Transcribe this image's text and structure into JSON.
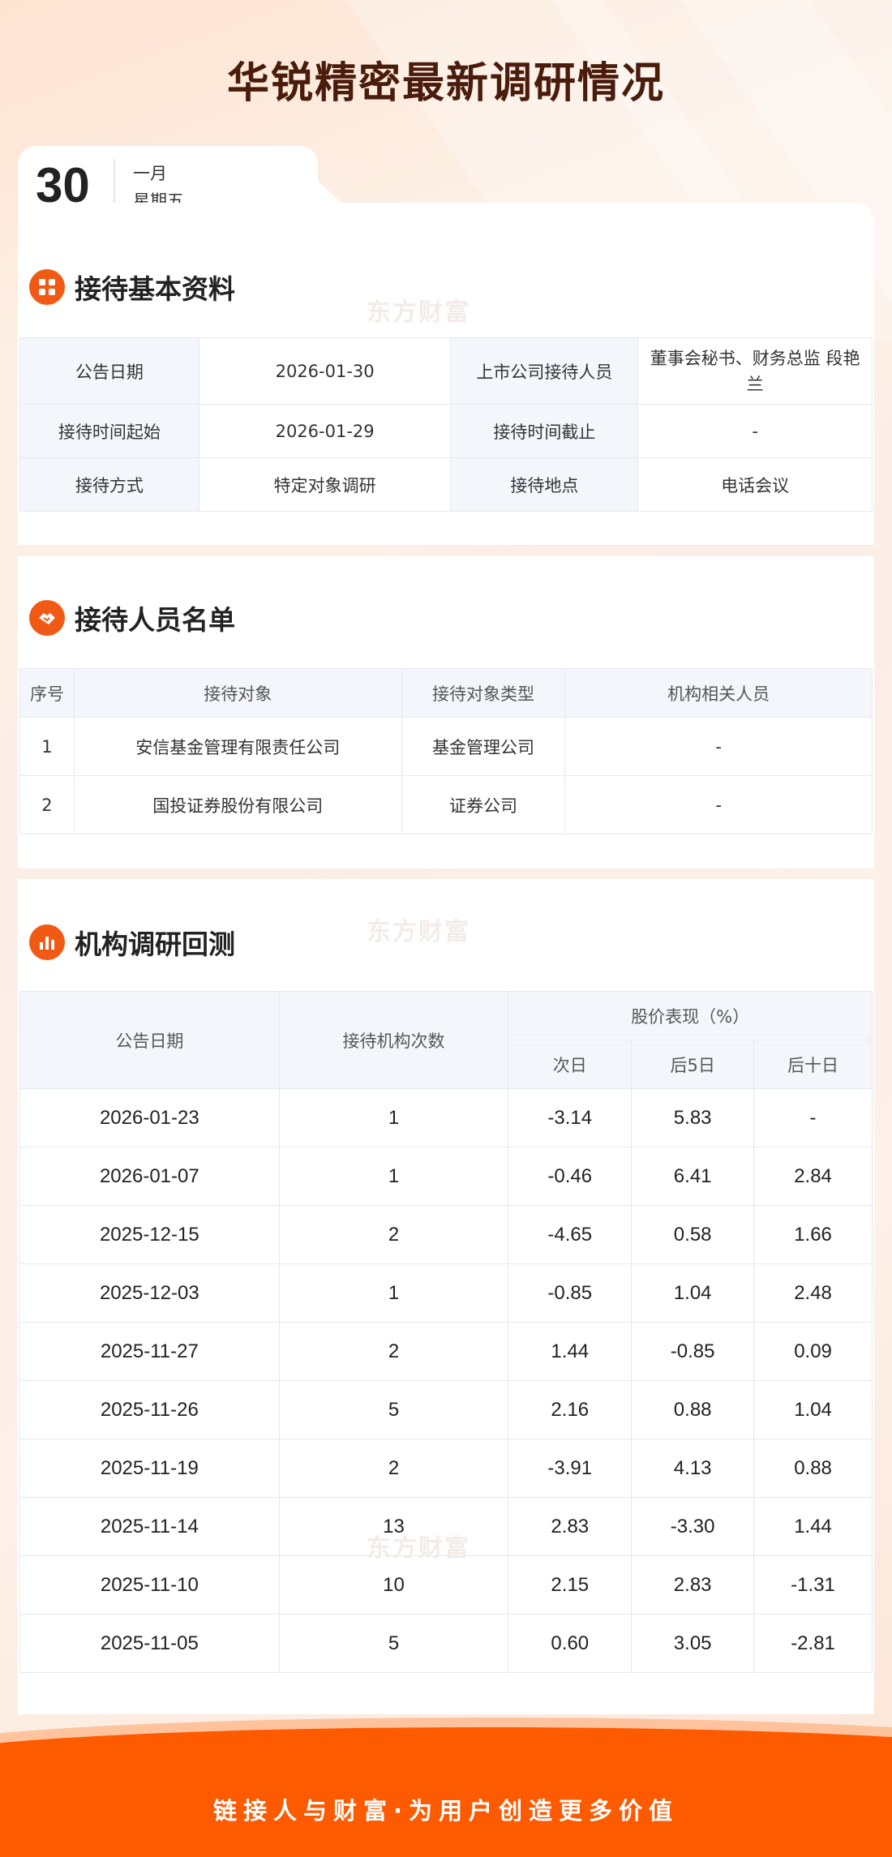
{
  "title": "华锐精密最新调研情况",
  "date": {
    "day": "30",
    "month": "一月",
    "weekday": "星期五"
  },
  "watermark": "东方财富",
  "basic": {
    "section_title": "接待基本资料",
    "rows": [
      [
        "公告日期",
        "2026-01-30",
        "上市公司接待人员",
        "董事会秘书、财务总监 段艳兰"
      ],
      [
        "接待时间起始",
        "2026-01-29",
        "接待时间截止",
        "-"
      ],
      [
        "接待方式",
        "特定对象调研",
        "接待地点",
        "电话会议"
      ]
    ]
  },
  "roster": {
    "section_title": "接待人员名单",
    "headers": [
      "序号",
      "接待对象",
      "接待对象类型",
      "机构相关人员"
    ],
    "rows": [
      [
        "1",
        "安信基金管理有限责任公司",
        "基金管理公司",
        "-"
      ],
      [
        "2",
        "国投证券股份有限公司",
        "证券公司",
        "-"
      ]
    ]
  },
  "backtest": {
    "section_title": "机构调研回测",
    "headers": {
      "date": "公告日期",
      "count": "接待机构次数",
      "perf": "股价表现（%）",
      "d1": "次日",
      "d5": "后5日",
      "d10": "后十日"
    },
    "rows": [
      [
        "2026-01-23",
        "1",
        "-3.14",
        "5.83",
        "-"
      ],
      [
        "2026-01-07",
        "1",
        "-0.46",
        "6.41",
        "2.84"
      ],
      [
        "2025-12-15",
        "2",
        "-4.65",
        "0.58",
        "1.66"
      ],
      [
        "2025-12-03",
        "1",
        "-0.85",
        "1.04",
        "2.48"
      ],
      [
        "2025-11-27",
        "2",
        "1.44",
        "-0.85",
        "0.09"
      ],
      [
        "2025-11-26",
        "5",
        "2.16",
        "0.88",
        "1.04"
      ],
      [
        "2025-11-19",
        "2",
        "-3.91",
        "4.13",
        "0.88"
      ],
      [
        "2025-11-14",
        "13",
        "2.83",
        "-3.30",
        "1.44"
      ],
      [
        "2025-11-10",
        "10",
        "2.15",
        "2.83",
        "-1.31"
      ],
      [
        "2025-11-05",
        "5",
        "0.60",
        "3.05",
        "-2.81"
      ]
    ]
  },
  "footer": {
    "slogan": "链接人与财富·为用户创造更多价值"
  },
  "colors": {
    "accent": "#fe5a00",
    "title": "#4a1c0c",
    "header_bg": "#f3f7fc"
  },
  "icons": {
    "basic": "grid-icon",
    "roster": "handshake-icon",
    "backtest": "bar-chart-icon"
  }
}
